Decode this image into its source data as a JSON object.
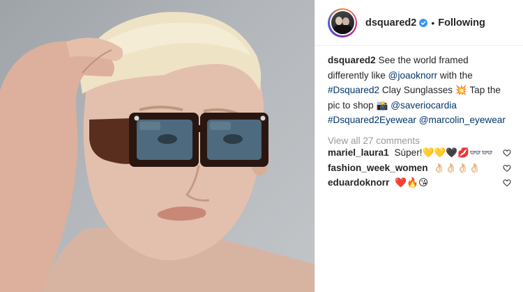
{
  "post": {
    "username": "dsquared2",
    "follow_status": "Following",
    "separator": "•"
  },
  "caption": {
    "username": "dsquared2",
    "text_1": "See the world framed differently like",
    "mention_1": "@joaoknorr",
    "text_2": "with the",
    "hashtag_1": "#Dsquared2",
    "text_3": "Clay Sunglasses",
    "emoji_1": "💥",
    "text_4": "Tap the pic to shop",
    "emoji_2": "📸",
    "mention_2": "@saveriocardia",
    "hashtag_2": "#Dsquared2Eyewear",
    "mention_3": "@marcolin_eyewear"
  },
  "comments": {
    "view_all": "View all 27 comments",
    "items": [
      {
        "username": "mariel_laura1",
        "text": "Súper!💛💛🖤💋👓👓"
      },
      {
        "username": "fashion_week_women",
        "text": "👌🏻👌🏻👌🏻👌🏻"
      },
      {
        "username": "eduardoknorr",
        "text": "❤️🔥😘"
      }
    ]
  },
  "colors": {
    "link": "#003569",
    "muted": "#999999",
    "text": "#262626",
    "verified": "#3897f0"
  },
  "icons": {
    "verified": "verified-badge-icon",
    "heart": "heart-outline-icon"
  }
}
